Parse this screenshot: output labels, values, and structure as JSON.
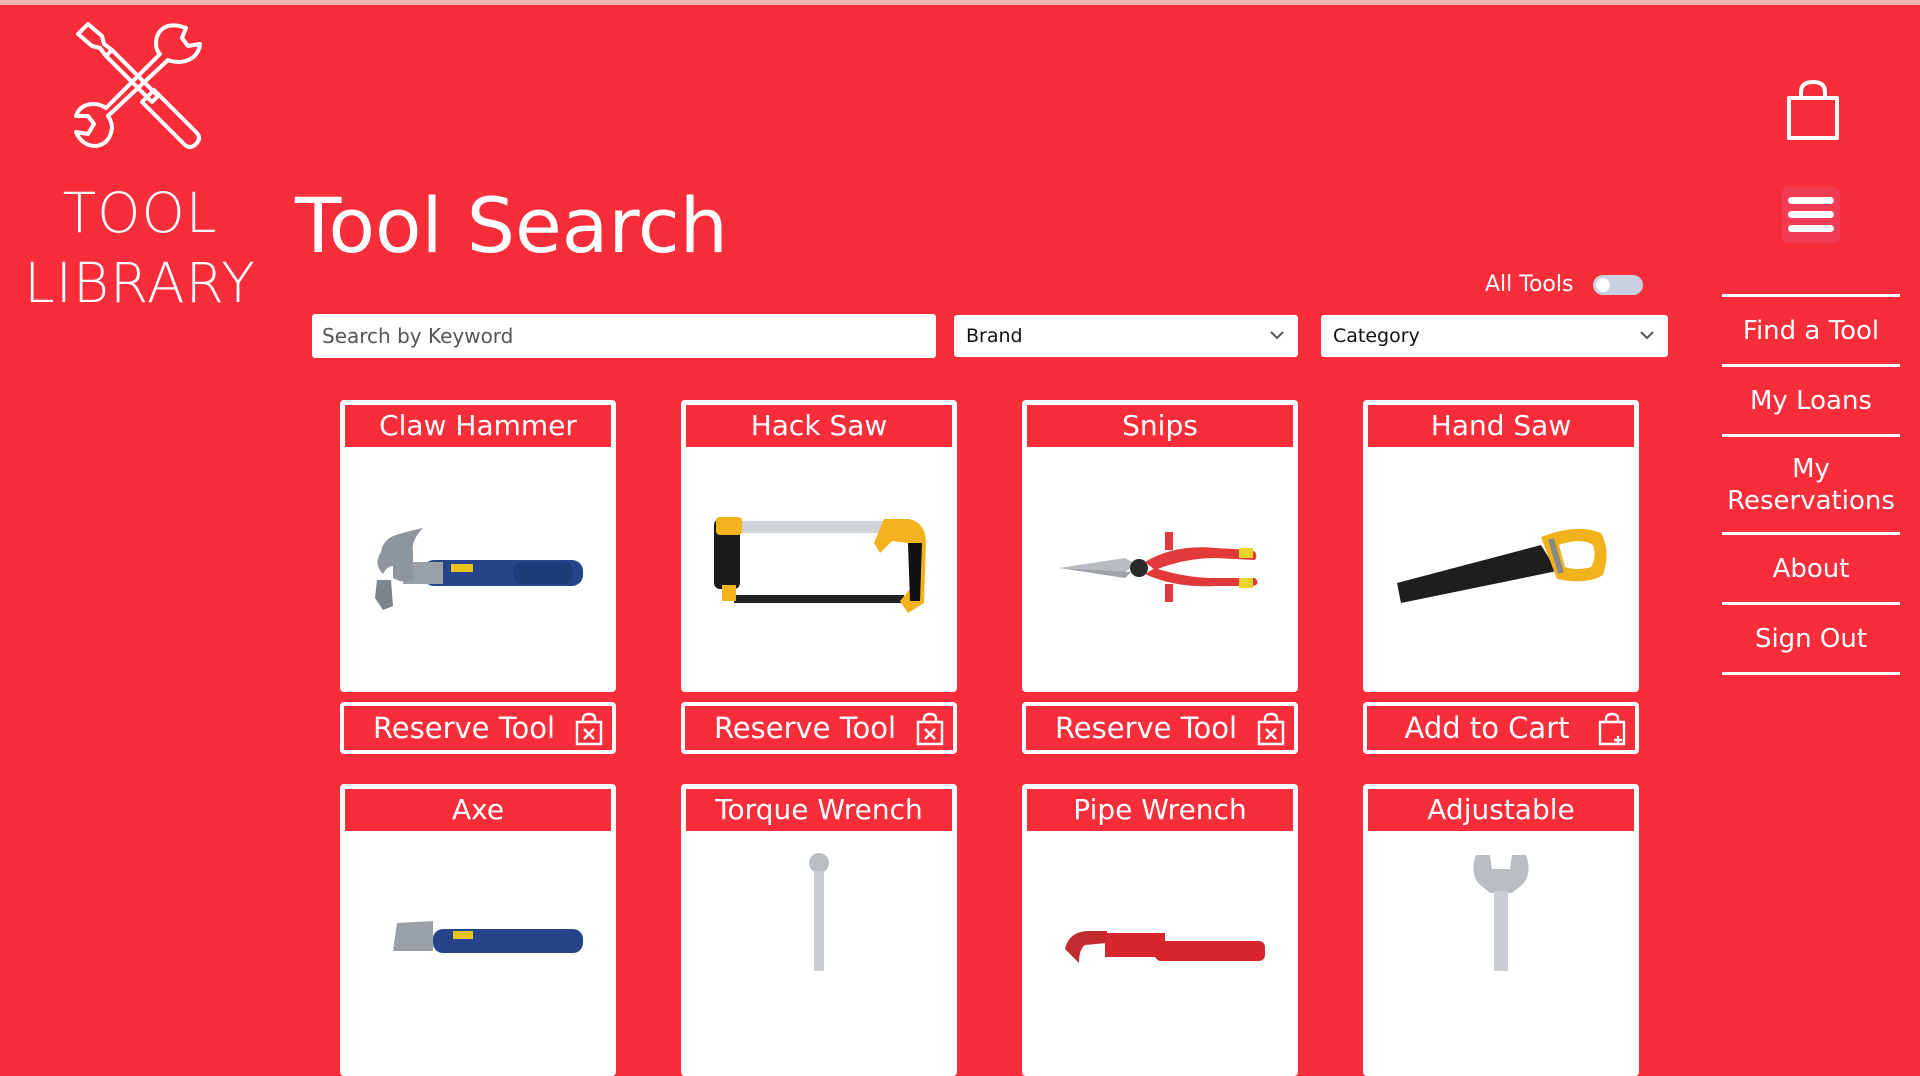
{
  "logo": {
    "line1": "TOOL",
    "line2": "LIBRARY"
  },
  "page": {
    "title": "Tool Search"
  },
  "filters": {
    "all_tools_label": "All Tools",
    "all_tools_on": false,
    "search_placeholder": "Search by Keyword",
    "brand_value": "Brand",
    "category_value": "Category"
  },
  "nav": {
    "find_tool": "Find a Tool",
    "my_loans": "My Loans",
    "my_reservations_line1": "My",
    "my_reservations_line2": "Reservations",
    "about": "About",
    "sign_out": "Sign Out"
  },
  "tools": [
    {
      "name": "Claw Hammer",
      "action": "Reserve Tool",
      "action_icon": "bag-x-icon",
      "image_icon": "claw-hammer-icon"
    },
    {
      "name": "Hack Saw",
      "action": "Reserve Tool",
      "action_icon": "bag-x-icon",
      "image_icon": "hack-saw-icon"
    },
    {
      "name": "Snips",
      "action": "Reserve Tool",
      "action_icon": "bag-x-icon",
      "image_icon": "snips-icon"
    },
    {
      "name": "Hand Saw",
      "action": "Add to Cart",
      "action_icon": "bag-plus-icon",
      "image_icon": "hand-saw-icon"
    },
    {
      "name": "Axe",
      "image_icon": "axe-icon"
    },
    {
      "name": "Torque Wrench",
      "image_icon": "torque-wrench-icon"
    },
    {
      "name": "Pipe Wrench",
      "image_icon": "pipe-wrench-icon"
    },
    {
      "name": "Adjustable",
      "image_icon": "adjustable-wrench-icon"
    }
  ],
  "colors": {
    "brand_red": "#f82d3a",
    "white": "#ffffff",
    "toggle_off": "#c7d0de"
  }
}
